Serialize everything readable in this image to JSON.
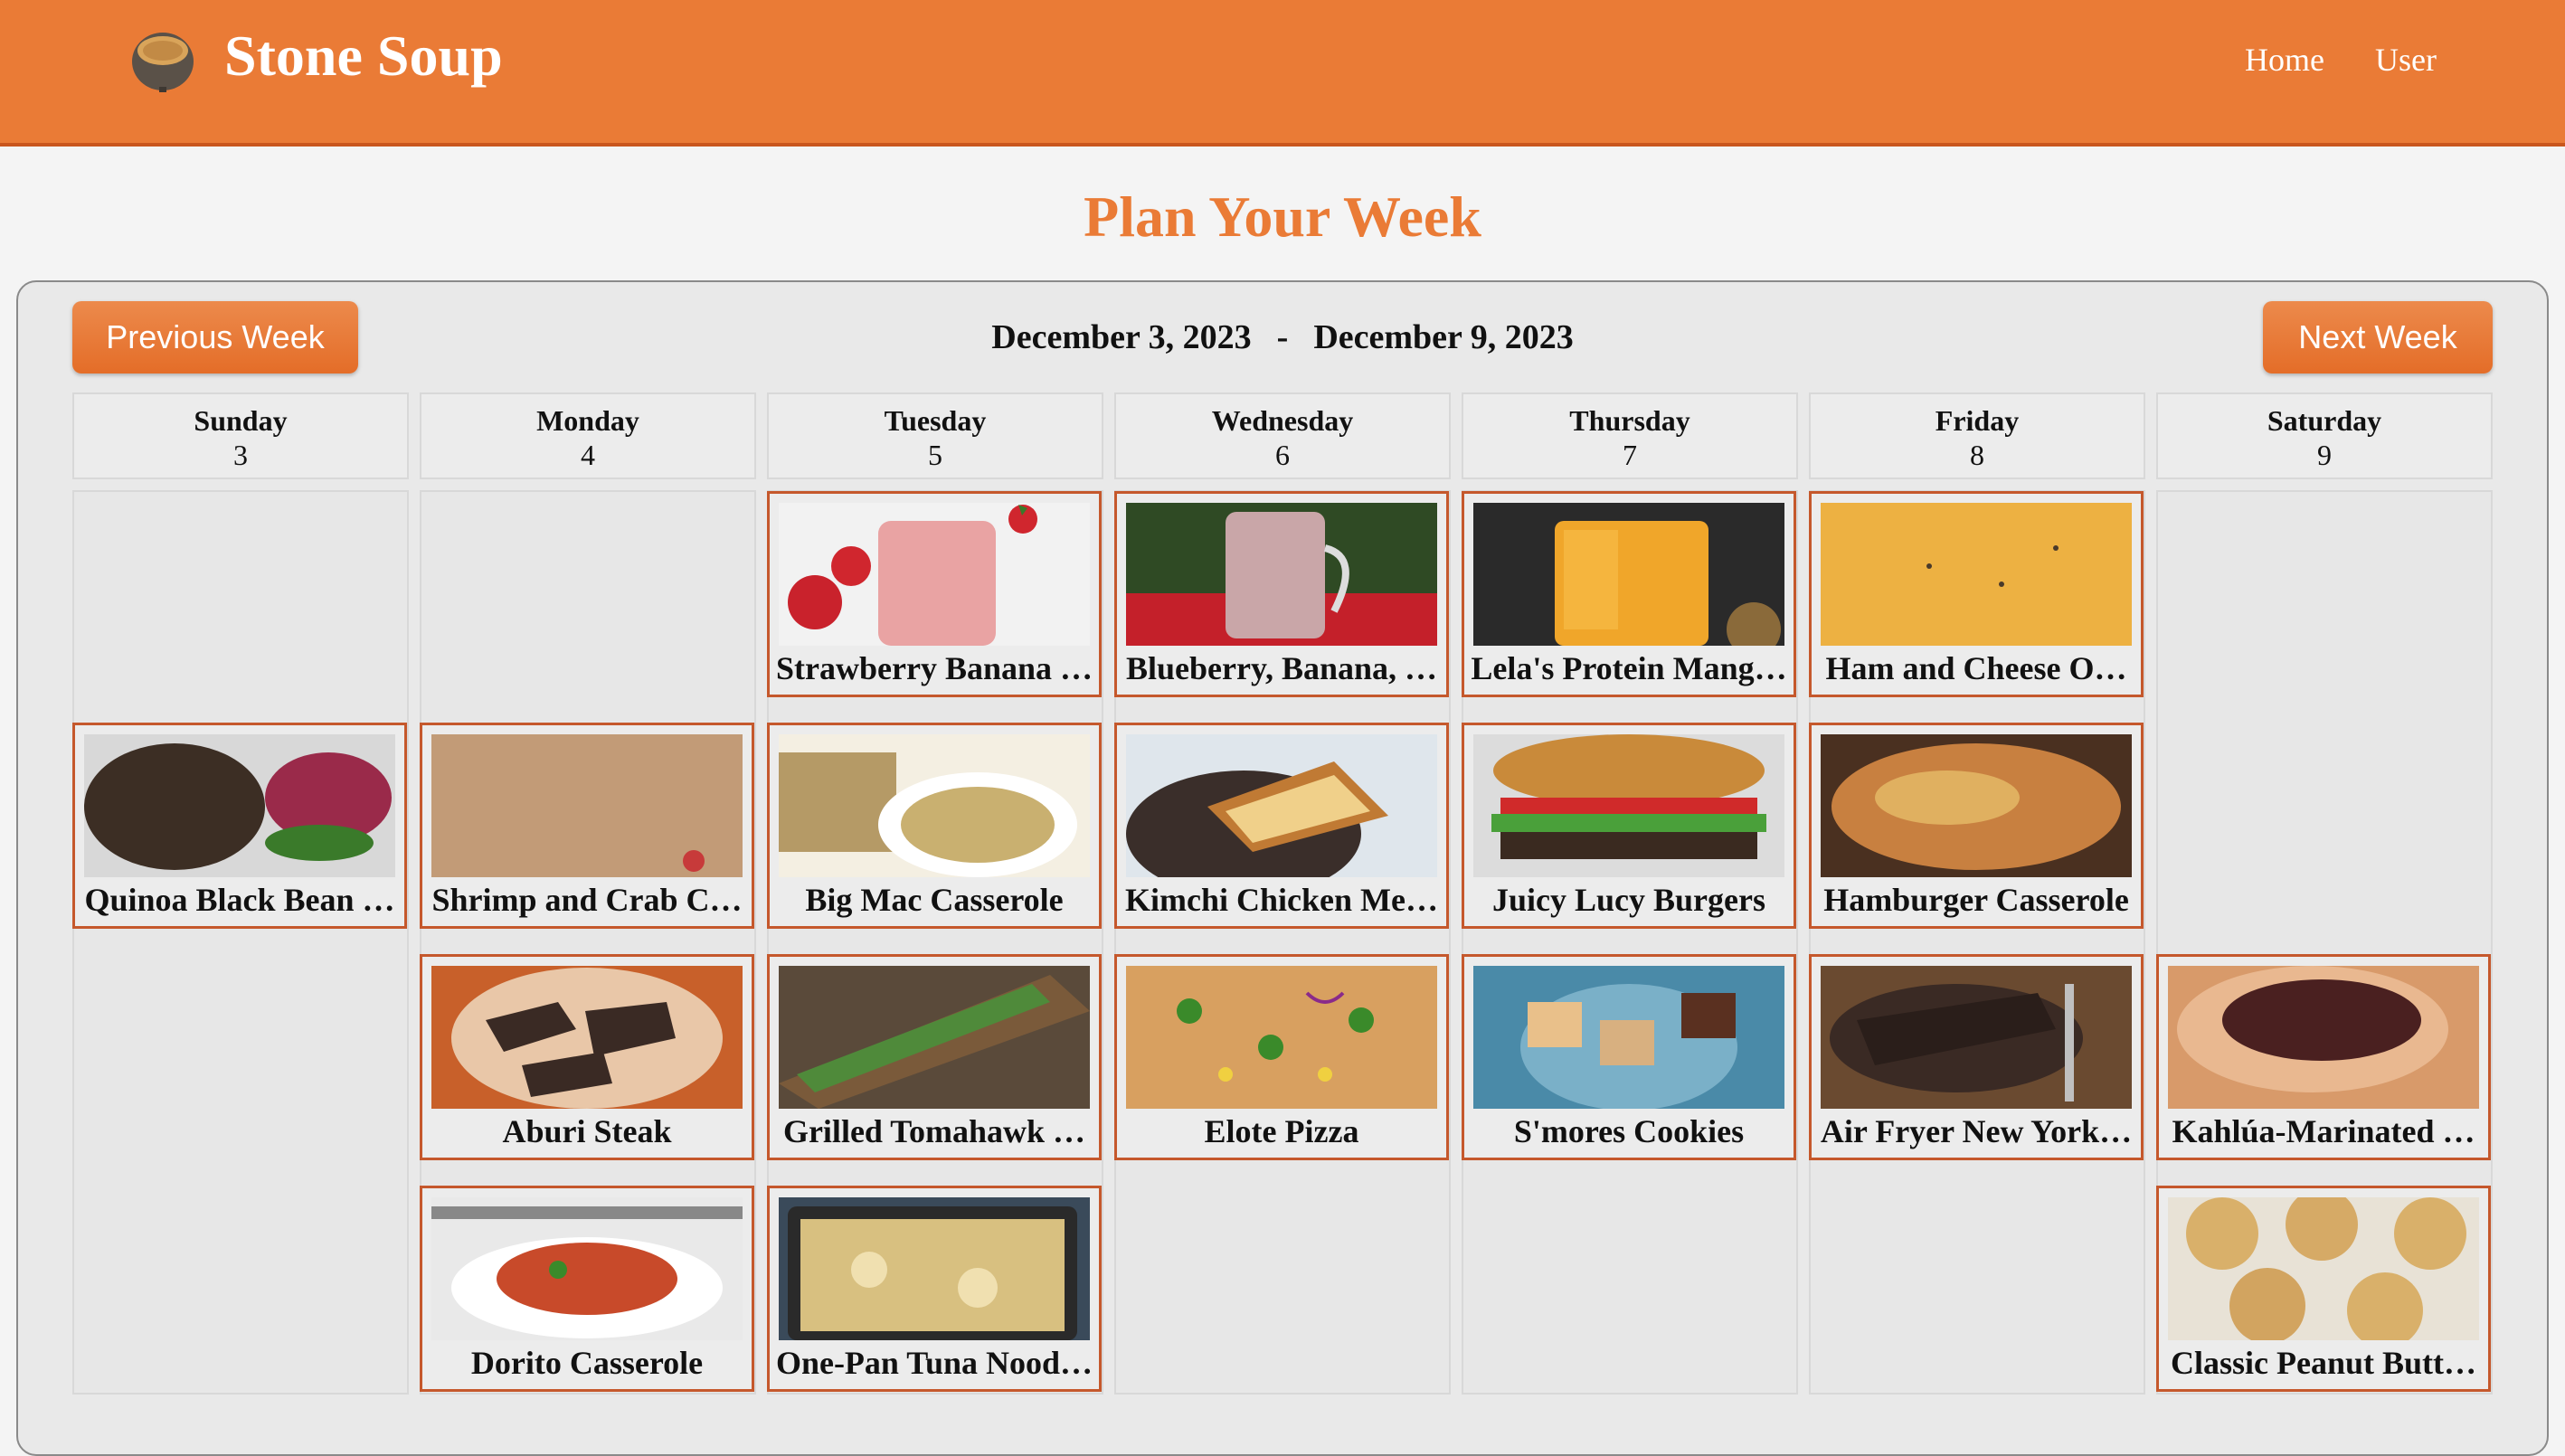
{
  "app": {
    "name": "Stone Soup"
  },
  "nav": {
    "home": "Home",
    "user": "User"
  },
  "page": {
    "title": "Plan Your Week"
  },
  "week": {
    "prev_label": "Previous Week",
    "next_label": "Next Week",
    "start": "December 3, 2023",
    "separator": "-",
    "end": "December 9, 2023"
  },
  "days": [
    {
      "name": "Sunday",
      "num": "3"
    },
    {
      "name": "Monday",
      "num": "4"
    },
    {
      "name": "Tuesday",
      "num": "5"
    },
    {
      "name": "Wednesday",
      "num": "6"
    },
    {
      "name": "Thursday",
      "num": "7"
    },
    {
      "name": "Friday",
      "num": "8"
    },
    {
      "name": "Saturday",
      "num": "9"
    }
  ],
  "meals": [
    {
      "slot": "breakfast",
      "recipes": [
        "",
        "",
        "Strawberry Banana …",
        "Blueberry, Banana, …",
        "Lela's Protein Mang…",
        "Ham and Cheese O…",
        ""
      ]
    },
    {
      "slot": "lunch",
      "recipes": [
        "Quinoa Black Bean …",
        "Shrimp and Crab C…",
        "Big Mac Casserole",
        "Kimchi Chicken Me…",
        "Juicy Lucy Burgers",
        "Hamburger Casserole",
        ""
      ]
    },
    {
      "slot": "dinner",
      "recipes": [
        "",
        "Aburi Steak",
        "Grilled Tomahawk …",
        "Elote Pizza",
        "S'mores Cookies",
        "Air Fryer New York…",
        "Kahlúa-Marinated …"
      ]
    },
    {
      "slot": "extra",
      "recipes": [
        "",
        "Dorito Casserole",
        "One-Pan Tuna Nood…",
        "",
        "",
        "",
        "Classic Peanut Butt…"
      ]
    }
  ],
  "colors": {
    "brand": "#ea7b36",
    "card_border": "#c5582c"
  }
}
